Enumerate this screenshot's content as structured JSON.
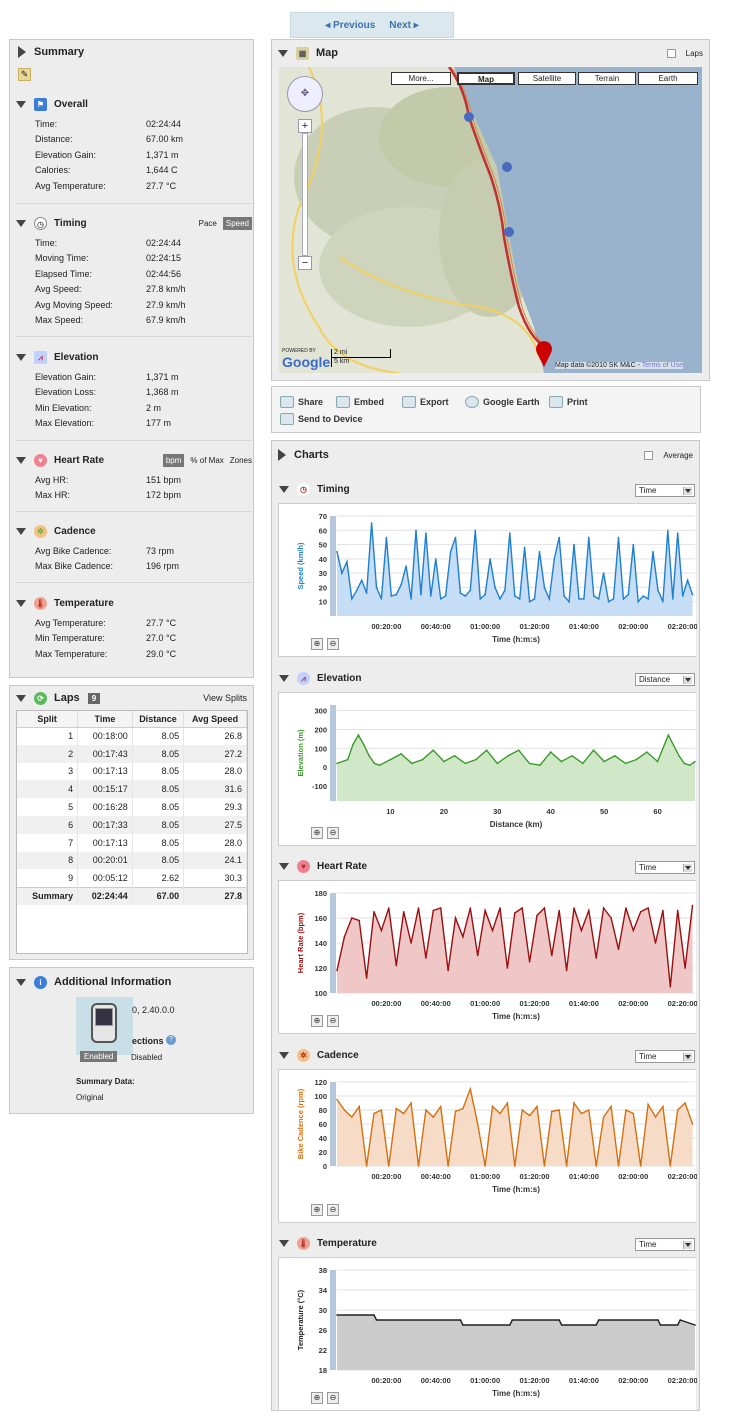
{
  "nav": {
    "prev": "Previous",
    "next": "Next"
  },
  "summary": {
    "title": "Summary",
    "overall": {
      "title": "Overall",
      "rows": [
        [
          "Time:",
          "02:24:44"
        ],
        [
          "Distance:",
          "67.00 km"
        ],
        [
          "Elevation Gain:",
          "1,371 m"
        ],
        [
          "Calories:",
          "1,644 C"
        ],
        [
          "Avg Temperature:",
          "27.7 °C"
        ]
      ]
    },
    "timing": {
      "title": "Timing",
      "opt1": "Pace",
      "opt2": "Speed",
      "rows": [
        [
          "Time:",
          "02:24:44"
        ],
        [
          "Moving Time:",
          "02:24:15"
        ],
        [
          "Elapsed Time:",
          "02:44:56"
        ],
        [
          "Avg Speed:",
          "27.8 km/h"
        ],
        [
          "Avg Moving Speed:",
          "27.9 km/h"
        ],
        [
          "Max Speed:",
          "67.9 km/h"
        ]
      ]
    },
    "elevation": {
      "title": "Elevation",
      "rows": [
        [
          "Elevation Gain:",
          "1,371 m"
        ],
        [
          "Elevation Loss:",
          "1,368 m"
        ],
        [
          "Min Elevation:",
          "2 m"
        ],
        [
          "Max Elevation:",
          "177 m"
        ]
      ]
    },
    "heartrate": {
      "title": "Heart Rate",
      "opt1": "bpm",
      "opt2": "% of Max",
      "opt3": "Zones",
      "rows": [
        [
          "Avg HR:",
          "151 bpm"
        ],
        [
          "Max HR:",
          "172 bpm"
        ]
      ]
    },
    "cadence": {
      "title": "Cadence",
      "rows": [
        [
          "Avg Bike Cadence:",
          "73 rpm"
        ],
        [
          "Max Bike Cadence:",
          "196 rpm"
        ]
      ]
    },
    "temperature": {
      "title": "Temperature",
      "rows": [
        [
          "Avg Temperature:",
          "27.7 °C"
        ],
        [
          "Min Temperature:",
          "27.0 °C"
        ],
        [
          "Max Temperature:",
          "29.0 °C"
        ]
      ]
    }
  },
  "laps": {
    "title": "Laps",
    "count": "9",
    "view": "View Splits",
    "headers": [
      "Split",
      "Time",
      "Distance",
      "Avg Speed"
    ],
    "rows": [
      [
        "1",
        "00:18:00",
        "8.05",
        "26.8"
      ],
      [
        "2",
        "00:17:43",
        "8.05",
        "27.2"
      ],
      [
        "3",
        "00:17:13",
        "8.05",
        "28.0"
      ],
      [
        "4",
        "00:15:17",
        "8.05",
        "31.6"
      ],
      [
        "5",
        "00:16:28",
        "8.05",
        "29.3"
      ],
      [
        "6",
        "00:17:33",
        "8.05",
        "27.5"
      ],
      [
        "7",
        "00:17:13",
        "8.05",
        "28.0"
      ],
      [
        "8",
        "00:20:01",
        "8.05",
        "24.1"
      ],
      [
        "9",
        "00:05:12",
        "2.62",
        "30.3"
      ]
    ],
    "summary": [
      "Summary",
      "02:24:44",
      "67.00",
      "27.8"
    ]
  },
  "info": {
    "title": "Additional Information",
    "version": "0, 2.40.0.0",
    "corrections": "ections",
    "enabled": "Enabled",
    "disabled": "Disabled",
    "summary_label": "Summary Data:",
    "summary_value": "Original"
  },
  "map": {
    "title": "Map",
    "laps": "Laps",
    "types": [
      "More...",
      "Map",
      "Satellite",
      "Terrain",
      "Earth"
    ],
    "scale_mi": "2 mi",
    "scale_km": "5 km",
    "powered": "POWERED BY",
    "google": "Google",
    "credit": "Map data ©2010 SK M&C -",
    "terms": "Terms of Use"
  },
  "toolbar": {
    "share": "Share",
    "embed": "Embed",
    "export": "Export",
    "earth": "Google Earth",
    "print": "Print",
    "send": "Send to Device"
  },
  "charts": {
    "title": "Charts",
    "average": "Average",
    "timing": {
      "title": "Timing",
      "select": "Time",
      "ylabel": "Speed (km/h)",
      "xlabel": "Time (h:m:s)"
    },
    "elevation": {
      "title": "Elevation",
      "select": "Distance",
      "ylabel": "Elevation (m)",
      "xlabel": "Distance (km)"
    },
    "heartrate": {
      "title": "Heart Rate",
      "select": "Time",
      "ylabel": "Heart Rate (bpm)",
      "xlabel": "Time (h:m:s)"
    },
    "cadence": {
      "title": "Cadence",
      "select": "Time",
      "ylabel": "Bike Cadence (rpm)",
      "xlabel": "Time (h:m:s)"
    },
    "temperature": {
      "title": "Temperature",
      "select": "Time",
      "ylabel": "Temperature (°C)",
      "xlabel": "Time (h:m:s)"
    }
  },
  "colors": {
    "speed": "#1f7fd0",
    "elev": "#3a9a2a",
    "hr": "#9a1010",
    "cad": "#d47010",
    "temp": "#222222"
  },
  "chart_data": [
    {
      "type": "area",
      "title": "",
      "ylabel": "Speed (km/h)",
      "xlabel": "Time (h:m:s)",
      "yticks": [
        10,
        20,
        30,
        40,
        50,
        60,
        70
      ],
      "ylim": [
        0,
        70
      ],
      "xticks": [
        "00:20:00",
        "00:40:00",
        "01:00:00",
        "01:20:00",
        "01:40:00",
        "02:00:00",
        "02:20:00"
      ],
      "xlim_min": [
        0,
        145
      ],
      "x": [
        0,
        2,
        4,
        6,
        8,
        10,
        12,
        14,
        16,
        18,
        20,
        22,
        24,
        26,
        28,
        30,
        32,
        34,
        36,
        38,
        40,
        42,
        44,
        46,
        48,
        50,
        52,
        54,
        56,
        58,
        60,
        62,
        64,
        66,
        68,
        70,
        72,
        74,
        76,
        78,
        80,
        82,
        84,
        86,
        88,
        90,
        92,
        94,
        96,
        98,
        100,
        102,
        104,
        106,
        108,
        110,
        112,
        114,
        116,
        118,
        120,
        122,
        124,
        126,
        128,
        130,
        132,
        134,
        136,
        138,
        140,
        142,
        144
      ],
      "values": [
        45,
        30,
        38,
        12,
        18,
        25,
        16,
        65,
        20,
        12,
        55,
        14,
        15,
        22,
        35,
        12,
        60,
        15,
        58,
        14,
        40,
        12,
        14,
        45,
        55,
        16,
        14,
        18,
        60,
        12,
        15,
        40,
        20,
        12,
        18,
        58,
        14,
        12,
        48,
        10,
        12,
        45,
        20,
        12,
        40,
        55,
        14,
        10,
        50,
        12,
        12,
        55,
        14,
        12,
        30,
        10,
        12,
        55,
        12,
        15,
        50,
        10,
        14,
        12,
        45,
        18,
        10,
        60,
        12,
        58,
        14,
        25,
        15
      ]
    },
    {
      "type": "area",
      "title": "",
      "ylabel": "Elevation (m)",
      "xlabel": "Distance (km)",
      "yticks": [
        -100,
        0,
        100,
        200,
        300
      ],
      "ylim": [
        -180,
        330
      ],
      "xticks": [
        10,
        20,
        30,
        40,
        50,
        60
      ],
      "xlim": [
        0,
        67
      ],
      "x": [
        0,
        2,
        3,
        4,
        5,
        6,
        7,
        8,
        10,
        12,
        14,
        16,
        18,
        20,
        22,
        24,
        26,
        28,
        30,
        32,
        34,
        36,
        38,
        40,
        42,
        44,
        46,
        48,
        50,
        52,
        54,
        56,
        58,
        60,
        62,
        64,
        65,
        66,
        67
      ],
      "values": [
        20,
        40,
        120,
        170,
        120,
        60,
        20,
        10,
        40,
        70,
        20,
        40,
        90,
        30,
        60,
        20,
        40,
        90,
        20,
        60,
        90,
        20,
        10,
        80,
        30,
        60,
        20,
        90,
        30,
        60,
        20,
        40,
        80,
        30,
        170,
        60,
        20,
        10,
        30
      ]
    },
    {
      "type": "area",
      "title": "",
      "ylabel": "Heart Rate (bpm)",
      "xlabel": "Time (h:m:s)",
      "yticks": [
        100,
        120,
        140,
        160,
        180
      ],
      "ylim": [
        100,
        180
      ],
      "xticks": [
        "00:20:00",
        "00:40:00",
        "01:00:00",
        "01:20:00",
        "01:40:00",
        "02:00:00",
        "02:20:00"
      ],
      "xlim_min": [
        0,
        145
      ],
      "x": [
        0,
        3,
        6,
        9,
        12,
        15,
        18,
        21,
        24,
        27,
        30,
        33,
        36,
        39,
        42,
        45,
        48,
        51,
        54,
        57,
        60,
        63,
        66,
        69,
        72,
        75,
        78,
        81,
        84,
        87,
        90,
        93,
        96,
        99,
        102,
        105,
        108,
        111,
        114,
        117,
        120,
        123,
        126,
        129,
        132,
        135,
        138,
        141,
        144
      ],
      "values": [
        118,
        145,
        160,
        158,
        112,
        165,
        150,
        168,
        122,
        165,
        140,
        168,
        128,
        166,
        168,
        118,
        160,
        145,
        168,
        130,
        166,
        150,
        168,
        120,
        164,
        168,
        125,
        162,
        168,
        130,
        166,
        118,
        168,
        150,
        166,
        128,
        168,
        160,
        135,
        168,
        150,
        165,
        168,
        140,
        166,
        105,
        166,
        120,
        170
      ]
    },
    {
      "type": "area",
      "title": "",
      "ylabel": "Bike Cadence (rpm)",
      "xlabel": "Time (h:m:s)",
      "yticks": [
        0,
        20,
        40,
        60,
        80,
        100,
        120
      ],
      "ylim": [
        0,
        120
      ],
      "xticks": [
        "00:20:00",
        "00:40:00",
        "01:00:00",
        "01:20:00",
        "01:40:00",
        "02:00:00",
        "02:20:00"
      ],
      "xlim_min": [
        0,
        145
      ],
      "x": [
        0,
        3,
        6,
        9,
        12,
        15,
        18,
        21,
        24,
        27,
        30,
        33,
        36,
        39,
        42,
        45,
        48,
        51,
        54,
        57,
        60,
        63,
        66,
        69,
        72,
        75,
        78,
        81,
        84,
        87,
        90,
        93,
        96,
        99,
        102,
        105,
        108,
        111,
        114,
        117,
        120,
        123,
        126,
        129,
        132,
        135,
        138,
        141,
        144
      ],
      "values": [
        95,
        80,
        70,
        85,
        0,
        75,
        80,
        0,
        82,
        75,
        90,
        0,
        80,
        70,
        85,
        0,
        78,
        82,
        110,
        60,
        0,
        85,
        75,
        90,
        0,
        80,
        72,
        85,
        0,
        78,
        80,
        0,
        90,
        75,
        80,
        0,
        70,
        85,
        0,
        80,
        75,
        0,
        88,
        70,
        85,
        0,
        80,
        90,
        60
      ]
    },
    {
      "type": "area",
      "title": "",
      "ylabel": "Temperature (°C)",
      "xlabel": "Time (h:m:s)",
      "yticks": [
        18,
        22,
        26,
        30,
        34,
        38
      ],
      "ylim": [
        18,
        38
      ],
      "xticks": [
        "00:20:00",
        "00:40:00",
        "01:00:00",
        "01:20:00",
        "01:40:00",
        "02:00:00",
        "02:20:00"
      ],
      "xlim_min": [
        0,
        145
      ],
      "x": [
        0,
        15,
        16,
        50,
        51,
        70,
        71,
        90,
        91,
        105,
        106,
        130,
        131,
        138,
        139,
        145
      ],
      "values": [
        29,
        29,
        28,
        28,
        27,
        27,
        28,
        28,
        27,
        27,
        28,
        28,
        27,
        27,
        28,
        27
      ]
    }
  ]
}
